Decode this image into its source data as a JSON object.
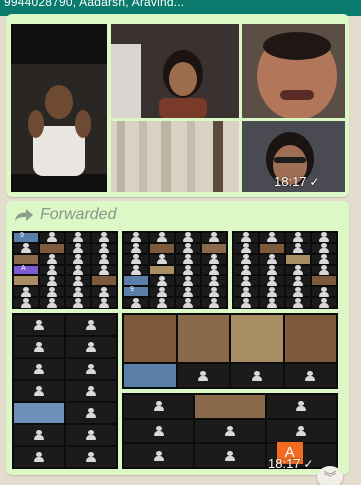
{
  "header": {
    "title": "9944028790, Aadarsh, Aravind..."
  },
  "message1": {
    "time": "18:17",
    "status_icon": "double-check-icon"
  },
  "message2": {
    "forwarded_label": "Forwarded",
    "time": "18:17",
    "status_icon": "double-check-icon",
    "avatar_letters": [
      "A",
      "A"
    ],
    "grid_numbers": [
      "9",
      "9"
    ]
  },
  "scroll_button": {
    "icon": "double-chevron-down-icon"
  },
  "colors": {
    "header": "#0a7a6c",
    "bubble": "#dcf8c6",
    "chat_background": "#e4dccd",
    "avatar_orange": "#f26b21",
    "avatar_purple": "#7b5bd6"
  }
}
